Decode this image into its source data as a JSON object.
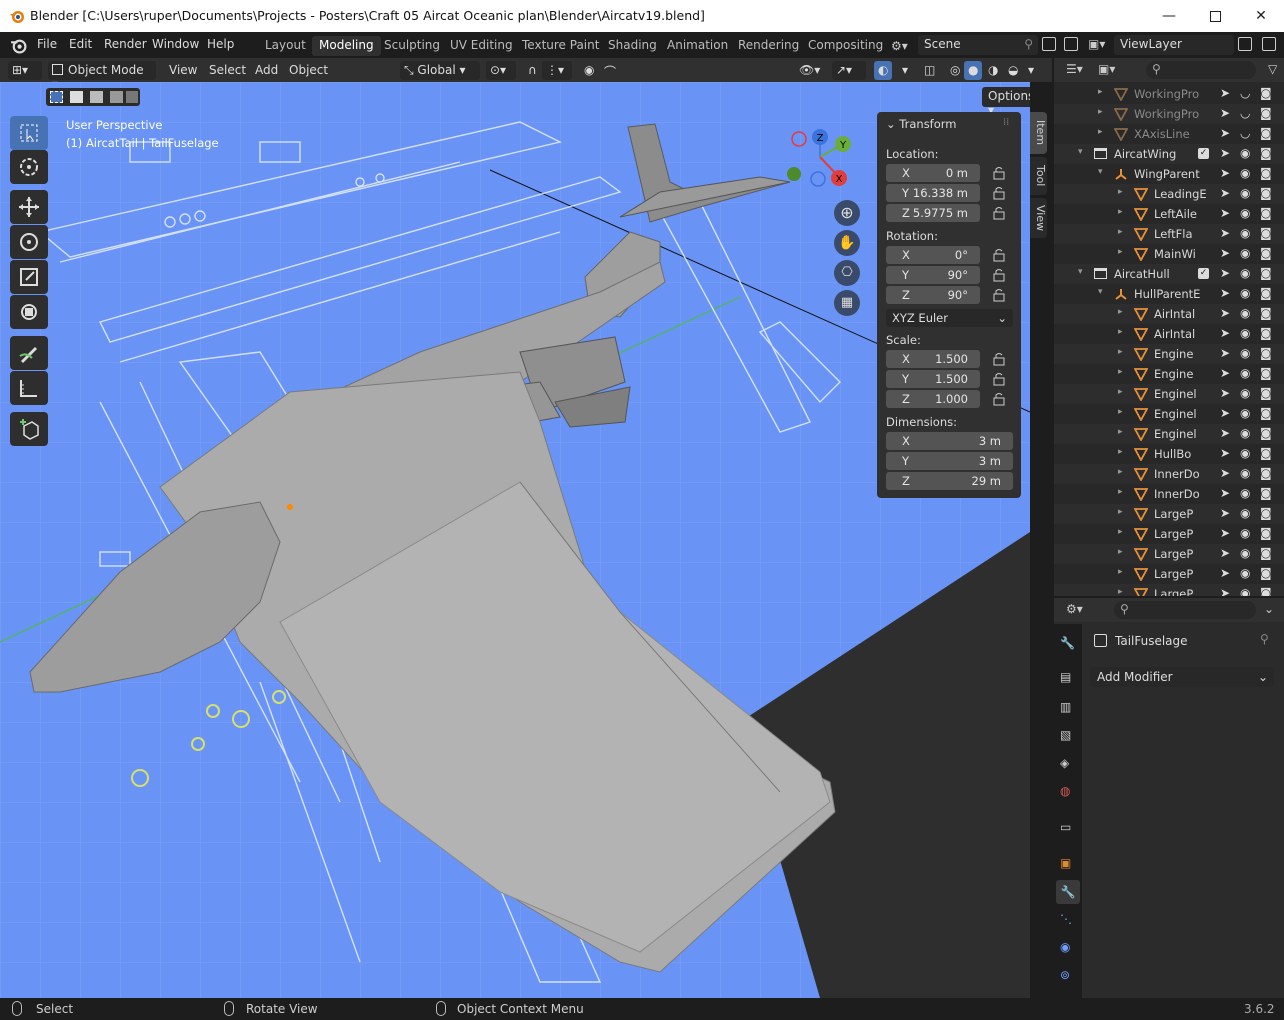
{
  "window": {
    "title": "Blender [C:\\Users\\ruper\\Documents\\Projects - Posters\\Craft 05 Aircat Oceanic plan\\Blender\\Aircatv19.blend]"
  },
  "menu": [
    "File",
    "Edit",
    "Render",
    "Window",
    "Help"
  ],
  "workspaces": [
    "Layout",
    "Modeling",
    "Sculpting",
    "UV Editing",
    "Texture Paint",
    "Shading",
    "Animation",
    "Rendering",
    "Compositing"
  ],
  "active_workspace": "Modeling",
  "scene": {
    "name": "Scene"
  },
  "view_layer": {
    "name": "ViewLayer"
  },
  "header3d": {
    "mode": "Object Mode",
    "menus": [
      "View",
      "Select",
      "Add",
      "Object"
    ],
    "orientation": "Global",
    "options": "Options"
  },
  "viewport": {
    "perspective": "User Perspective",
    "active": "(1) AircatTail | TailFuselage",
    "gizmo_axes": [
      "Z",
      "Y",
      "X"
    ]
  },
  "npanel": {
    "section": "Transform",
    "location_label": "Location:",
    "location": {
      "x": "0 m",
      "y": "16.338 m",
      "z": "5.9775 m"
    },
    "rotation_label": "Rotation:",
    "rotation": {
      "x": "0°",
      "y": "90°",
      "z": "90°"
    },
    "rotation_mode": "XYZ Euler",
    "scale_label": "Scale:",
    "scale": {
      "x": "1.500",
      "y": "1.500",
      "z": "1.000"
    },
    "dimensions_label": "Dimensions:",
    "dimensions": {
      "x": "3 m",
      "y": "3 m",
      "z": "29 m"
    },
    "axis": {
      "x": "X",
      "y": "Y",
      "z": "Z"
    },
    "tabs": [
      "Item",
      "Tool",
      "View"
    ]
  },
  "outliner": {
    "rows": [
      {
        "name": "WorkingPro",
        "type": "mesh-dim",
        "indent": 2
      },
      {
        "name": "WorkingPro",
        "type": "mesh-dim",
        "indent": 2
      },
      {
        "name": "XAxisLine",
        "type": "mesh-dim",
        "indent": 2
      },
      {
        "name": "AircatWing",
        "type": "collection",
        "indent": 1
      },
      {
        "name": "WingParent",
        "type": "empty",
        "indent": 2
      },
      {
        "name": "LeadingE",
        "type": "mesh",
        "indent": 3
      },
      {
        "name": "LeftAile",
        "type": "mesh",
        "indent": 3
      },
      {
        "name": "LeftFla",
        "type": "mesh",
        "indent": 3
      },
      {
        "name": "MainWi",
        "type": "mesh",
        "indent": 3
      },
      {
        "name": "AircatHull",
        "type": "collection",
        "indent": 1
      },
      {
        "name": "HullParentE",
        "type": "empty",
        "indent": 2
      },
      {
        "name": "AirIntal",
        "type": "mesh",
        "indent": 3
      },
      {
        "name": "AirIntal",
        "type": "mesh",
        "indent": 3
      },
      {
        "name": "Engine",
        "type": "mesh",
        "indent": 3
      },
      {
        "name": "Engine",
        "type": "mesh",
        "indent": 3
      },
      {
        "name": "Enginel",
        "type": "mesh",
        "indent": 3
      },
      {
        "name": "Enginel",
        "type": "mesh",
        "indent": 3
      },
      {
        "name": "Enginel",
        "type": "mesh",
        "indent": 3
      },
      {
        "name": "HullBo",
        "type": "mesh",
        "indent": 3
      },
      {
        "name": "InnerDo",
        "type": "mesh",
        "indent": 3
      },
      {
        "name": "InnerDo",
        "type": "mesh",
        "indent": 3
      },
      {
        "name": "LargeP",
        "type": "mesh",
        "indent": 3
      },
      {
        "name": "LargeP",
        "type": "mesh",
        "indent": 3
      },
      {
        "name": "LargeP",
        "type": "mesh",
        "indent": 3
      },
      {
        "name": "LargeP",
        "type": "mesh",
        "indent": 3
      },
      {
        "name": "LargeP",
        "type": "mesh",
        "indent": 3
      }
    ]
  },
  "properties": {
    "object": "TailFuselage",
    "add_modifier": "Add Modifier"
  },
  "status": {
    "left": "Select",
    "mid": "Rotate View",
    "right": "Object Context Menu",
    "version": "3.6.2"
  },
  "colors": {
    "accent": "#4772b3",
    "viewport": "#6994f6",
    "header": "#303030",
    "bg": "#1d1d1d"
  }
}
